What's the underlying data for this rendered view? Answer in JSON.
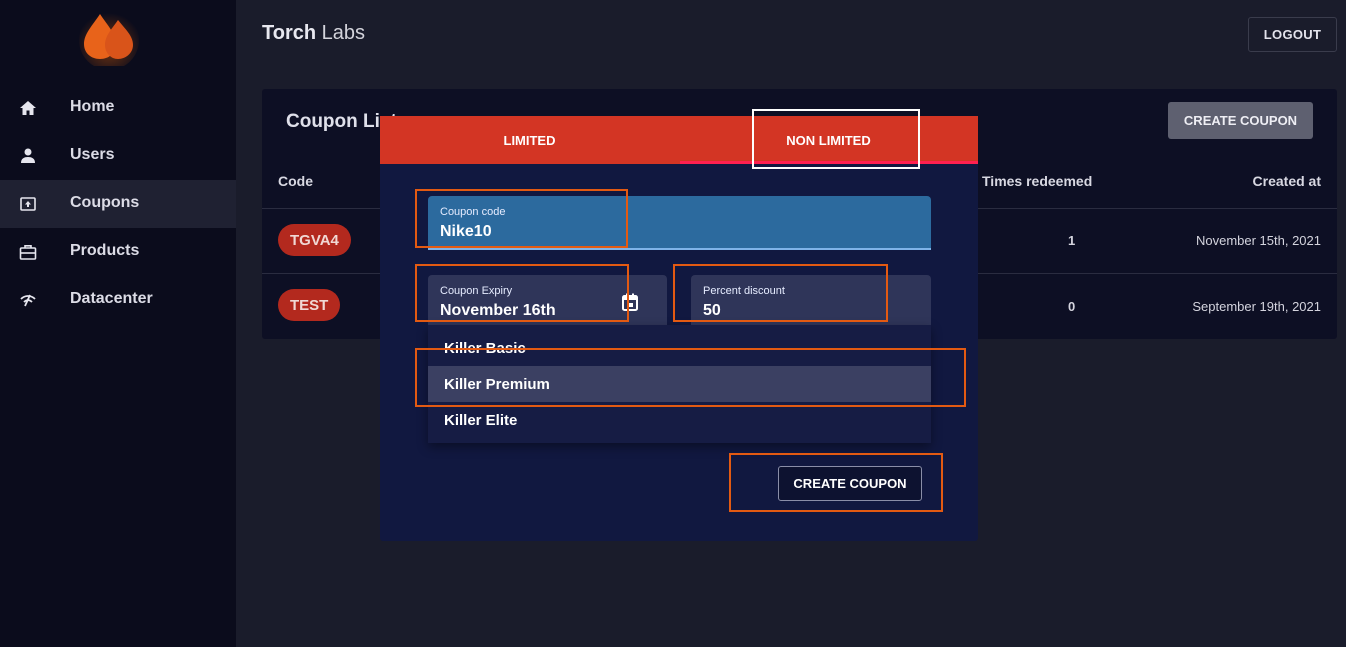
{
  "header": {
    "brand_bold": "Torch",
    "brand_rest": " Labs",
    "logout_label": "LOGOUT"
  },
  "sidebar": {
    "items": [
      {
        "label": "Home",
        "icon": "home-icon"
      },
      {
        "label": "Users",
        "icon": "user-icon"
      },
      {
        "label": "Coupons",
        "icon": "coupon-icon",
        "active": true
      },
      {
        "label": "Products",
        "icon": "briefcase-icon"
      },
      {
        "label": "Datacenter",
        "icon": "signal-icon"
      }
    ]
  },
  "coupon_list": {
    "title": "Coupon List",
    "create_label": "CREATE COUPON",
    "columns": {
      "code": "Code",
      "times_redeemed": "Times redeemed",
      "created_at": "Created at"
    },
    "rows": [
      {
        "code": "TGVA4",
        "times_redeemed": "1",
        "created_at": "November 15th, 2021"
      },
      {
        "code": "TEST",
        "times_redeemed": "0",
        "created_at": "September 19th, 2021"
      }
    ]
  },
  "modal": {
    "tabs": [
      {
        "label": "LIMITED"
      },
      {
        "label": "NON LIMITED",
        "active": true
      }
    ],
    "coupon_code": {
      "label": "Coupon code",
      "value": "Nike10"
    },
    "coupon_expiry": {
      "label": "Coupon Expiry",
      "value": "November 16th"
    },
    "percent_discount": {
      "label": "Percent discount",
      "value": "50"
    },
    "product_options": [
      {
        "label": "Killer Basic"
      },
      {
        "label": "Killer Premium",
        "selected": true
      },
      {
        "label": "Killer Elite"
      }
    ],
    "create_label": "CREATE COUPON"
  },
  "colors": {
    "accent_red": "#d33524",
    "highlight_orange": "#e35a12",
    "sidebar_bg": "#0b0c1c",
    "modal_bg": "#111840"
  }
}
